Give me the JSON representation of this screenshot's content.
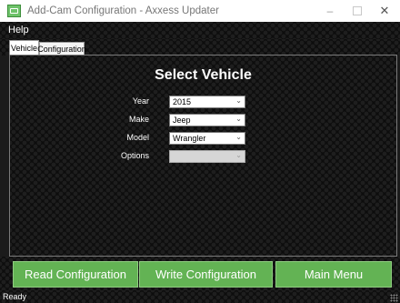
{
  "window": {
    "title": "Add-Cam Configuration - Axxess Updater",
    "icon": "app-icon",
    "controls": {
      "minimize": "–",
      "maximize": "",
      "close": "✕"
    }
  },
  "menu": {
    "help_label": "Help"
  },
  "tabs": [
    {
      "label": "Vehicle",
      "active": true
    },
    {
      "label": "Configuration",
      "active": false
    }
  ],
  "vehicle": {
    "heading": "Select Vehicle",
    "fields": {
      "year": {
        "label": "Year",
        "value": "2015"
      },
      "make": {
        "label": "Make",
        "value": "Jeep"
      },
      "model": {
        "label": "Model",
        "value": "Wrangler"
      },
      "options": {
        "label": "Options",
        "value": "",
        "disabled": true
      }
    }
  },
  "buttons": {
    "read": "Read Configuration",
    "write": "Write Configuration",
    "main_menu": "Main Menu"
  },
  "status": {
    "text": "Ready"
  },
  "colors": {
    "button_green": "#63b354",
    "background": "#0d0d0d",
    "text": "#ffffff"
  }
}
